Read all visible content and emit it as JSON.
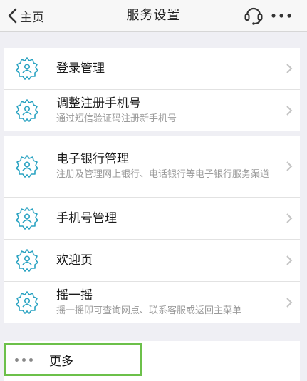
{
  "header": {
    "back_label": "主页",
    "title": "服务设置",
    "icons": [
      "customer-service-icon",
      "more-icon"
    ]
  },
  "group1": [
    {
      "title": "登录管理",
      "subtitle": ""
    },
    {
      "title": "调整注册手机号",
      "subtitle": "通过短信验证码注册新手机号"
    }
  ],
  "group2": [
    {
      "title": "电子银行管理",
      "subtitle": "注册及管理网上银行、电话银行等电子银行服务渠道"
    },
    {
      "title": "手机号管理",
      "subtitle": ""
    },
    {
      "title": "欢迎页",
      "subtitle": ""
    },
    {
      "title": "摇一摇",
      "subtitle": "摇一摇即可查询网点、联系客服或返回主菜单"
    }
  ],
  "footer": {
    "more_label": "更多"
  },
  "colors": {
    "accent": "#2aa3c2",
    "highlight": "#6cc04a",
    "background": "#efeff4"
  }
}
